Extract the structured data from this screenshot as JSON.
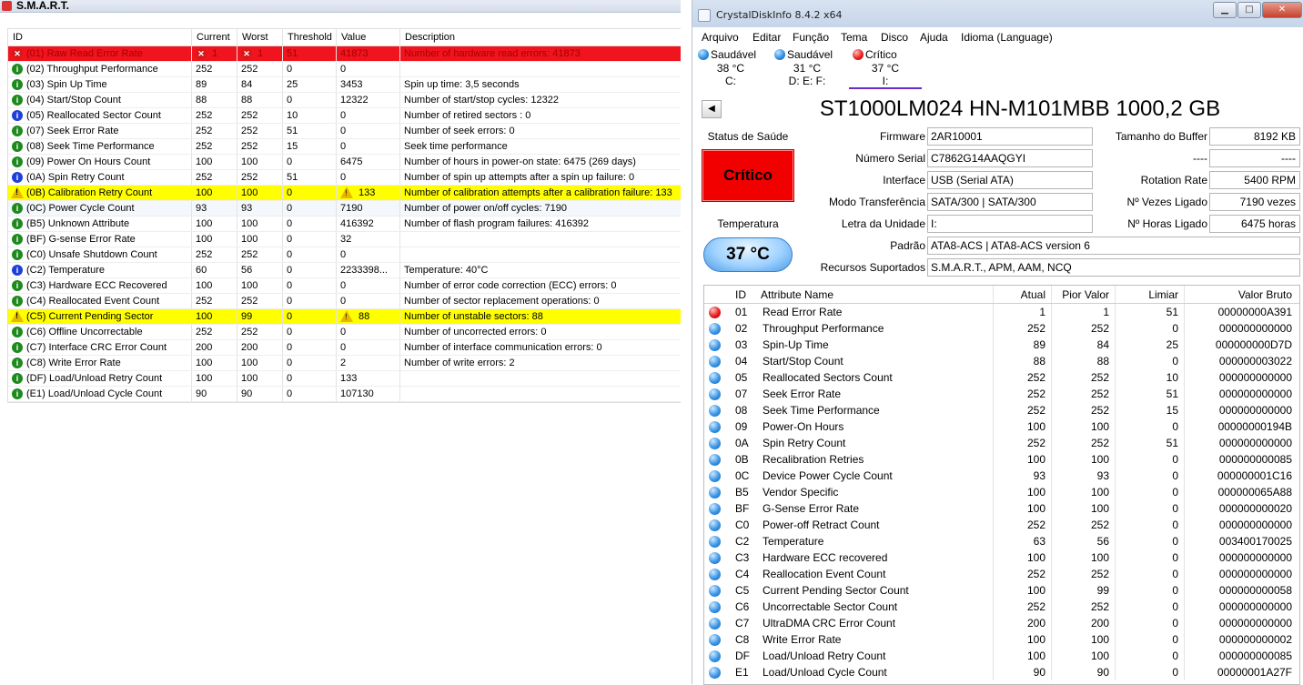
{
  "left": {
    "title": "S.M.A.R.T.",
    "headers": {
      "id": "ID",
      "current": "Current",
      "worst": "Worst",
      "threshold": "Threshold",
      "value": "Value",
      "description": "Description"
    },
    "rows": [
      {
        "status": "err",
        "name": "(01) Raw Read Error Rate",
        "current": "1",
        "worst": "1",
        "threshold": "51",
        "value": "41873",
        "desc": "Number of hardware read errors: 41873",
        "hl": "red",
        "icons": "err"
      },
      {
        "status": "ok",
        "name": "(02) Throughput Performance",
        "current": "252",
        "worst": "252",
        "threshold": "0",
        "value": "0",
        "desc": ""
      },
      {
        "status": "ok",
        "name": "(03) Spin Up Time",
        "current": "89",
        "worst": "84",
        "threshold": "25",
        "value": "3453",
        "desc": "Spin up time: 3,5 seconds"
      },
      {
        "status": "ok",
        "name": "(04) Start/Stop Count",
        "current": "88",
        "worst": "88",
        "threshold": "0",
        "value": "12322",
        "desc": "Number of start/stop cycles: 12322"
      },
      {
        "status": "info",
        "name": "(05) Reallocated Sector Count",
        "current": "252",
        "worst": "252",
        "threshold": "10",
        "value": "0",
        "desc": "Number of retired sectors : 0"
      },
      {
        "status": "ok",
        "name": "(07) Seek Error Rate",
        "current": "252",
        "worst": "252",
        "threshold": "51",
        "value": "0",
        "desc": "Number of seek errors: 0"
      },
      {
        "status": "ok",
        "name": "(08) Seek Time Performance",
        "current": "252",
        "worst": "252",
        "threshold": "15",
        "value": "0",
        "desc": "Seek time performance"
      },
      {
        "status": "ok",
        "name": "(09) Power On Hours Count",
        "current": "100",
        "worst": "100",
        "threshold": "0",
        "value": "6475",
        "desc": "Number of hours in power-on state: 6475 (269 days)"
      },
      {
        "status": "info",
        "name": "(0A) Spin Retry Count",
        "current": "252",
        "worst": "252",
        "threshold": "51",
        "value": "0",
        "desc": "Number of spin up attempts after a spin up failure: 0"
      },
      {
        "status": "warn",
        "name": "(0B) Calibration Retry Count",
        "current": "100",
        "worst": "100",
        "threshold": "0",
        "value": "133",
        "desc": "Number of calibration attempts after a calibration failure: 133",
        "hl": "yel",
        "icons": "warn"
      },
      {
        "status": "ok",
        "name": "(0C) Power Cycle Count",
        "current": "93",
        "worst": "93",
        "threshold": "0",
        "value": "7190",
        "desc": "Number of power on/off cycles: 7190",
        "hl": "sel"
      },
      {
        "status": "ok",
        "name": "(B5) Unknown Attribute",
        "current": "100",
        "worst": "100",
        "threshold": "0",
        "value": "416392",
        "desc": "Number of flash program failures: 416392"
      },
      {
        "status": "ok",
        "name": "(BF) G-sense Error Rate",
        "current": "100",
        "worst": "100",
        "threshold": "0",
        "value": "32",
        "desc": ""
      },
      {
        "status": "ok",
        "name": "(C0) Unsafe Shutdown Count",
        "current": "252",
        "worst": "252",
        "threshold": "0",
        "value": "0",
        "desc": ""
      },
      {
        "status": "info",
        "name": "(C2) Temperature",
        "current": "60",
        "worst": "56",
        "threshold": "0",
        "value": "2233398...",
        "desc": "Temperature: 40°C"
      },
      {
        "status": "ok",
        "name": "(C3) Hardware ECC Recovered",
        "current": "100",
        "worst": "100",
        "threshold": "0",
        "value": "0",
        "desc": "Number of error code correction (ECC) errors: 0"
      },
      {
        "status": "ok",
        "name": "(C4) Reallocated Event Count",
        "current": "252",
        "worst": "252",
        "threshold": "0",
        "value": "0",
        "desc": "Number of sector replacement operations: 0"
      },
      {
        "status": "warn",
        "name": "(C5) Current Pending Sector",
        "current": "100",
        "worst": "99",
        "threshold": "0",
        "value": "88",
        "desc": "Number of unstable sectors: 88",
        "hl": "yel",
        "icons": "warn"
      },
      {
        "status": "ok",
        "name": "(C6) Offline Uncorrectable",
        "current": "252",
        "worst": "252",
        "threshold": "0",
        "value": "0",
        "desc": "Number of uncorrected errors: 0"
      },
      {
        "status": "ok",
        "name": "(C7) Interface CRC Error Count",
        "current": "200",
        "worst": "200",
        "threshold": "0",
        "value": "0",
        "desc": "Number of interface communication errors: 0"
      },
      {
        "status": "ok",
        "name": "(C8) Write Error Rate",
        "current": "100",
        "worst": "100",
        "threshold": "0",
        "value": "2",
        "desc": "Number of write errors: 2"
      },
      {
        "status": "ok",
        "name": "(DF) Load/Unload Retry Count",
        "current": "100",
        "worst": "100",
        "threshold": "0",
        "value": "133",
        "desc": ""
      },
      {
        "status": "ok",
        "name": "(E1) Load/Unload Cycle Count",
        "current": "90",
        "worst": "90",
        "threshold": "0",
        "value": "107130",
        "desc": ""
      }
    ]
  },
  "right": {
    "window_title": "CrystalDiskInfo 8.4.2 x64",
    "menu": [
      "Arquivo",
      "Editar",
      "Função",
      "Tema",
      "Disco",
      "Ajuda",
      "Idioma (Language)"
    ],
    "drives": [
      {
        "status": "Saudável",
        "temp": "38 °C",
        "letter": "C:",
        "color": "blue"
      },
      {
        "status": "Saudável",
        "temp": "31 °C",
        "letter": "D: E: F:",
        "color": "blue"
      },
      {
        "status": "Crítico",
        "temp": "37 °C",
        "letter": "I:",
        "color": "red"
      }
    ],
    "model": "ST1000LM024 HN-M101MBB 1000,2 GB",
    "health_label": "Status de Saúde",
    "health_value": "Crítico",
    "temp_label": "Temperatura",
    "temp_value": "37 °C",
    "fields": {
      "firmware_label": "Firmware",
      "firmware": "2AR10001",
      "serial_label": "Número Serial",
      "serial": "C7862G14AAQGYI",
      "interface_label": "Interface",
      "interface": "USB (Serial ATA)",
      "transfer_label": "Modo Transferência",
      "transfer": "SATA/300 | SATA/300",
      "drive_letter_label": "Letra da Unidade",
      "drive_letter": "I:",
      "standard_label": "Padrão",
      "standard": "ATA8-ACS | ATA8-ACS version 6",
      "features_label": "Recursos Suportados",
      "features": "S.M.A.R.T., APM, AAM, NCQ",
      "buffer_label": "Tamanho do Buffer",
      "buffer": "8192 KB",
      "blank1_label": "----",
      "blank1": "----",
      "rotation_label": "Rotation Rate",
      "rotation": "5400 RPM",
      "power_count_label": "Nº Vezes Ligado",
      "power_count": "7190 vezes",
      "power_hours_label": "Nº Horas Ligado",
      "power_hours": "6475 horas"
    },
    "headers": {
      "id": "ID",
      "name": "Attribute Name",
      "current": "Atual",
      "worst": "Pior Valor",
      "threshold": "Limiar",
      "raw": "Valor Bruto"
    },
    "rows": [
      {
        "c": "red",
        "id": "01",
        "name": "Read Error Rate",
        "cur": "1",
        "worst": "1",
        "thr": "51",
        "raw": "00000000A391"
      },
      {
        "c": "blue",
        "id": "02",
        "name": "Throughput Performance",
        "cur": "252",
        "worst": "252",
        "thr": "0",
        "raw": "000000000000"
      },
      {
        "c": "blue",
        "id": "03",
        "name": "Spin-Up Time",
        "cur": "89",
        "worst": "84",
        "thr": "25",
        "raw": "000000000D7D"
      },
      {
        "c": "blue",
        "id": "04",
        "name": "Start/Stop Count",
        "cur": "88",
        "worst": "88",
        "thr": "0",
        "raw": "000000003022"
      },
      {
        "c": "blue",
        "id": "05",
        "name": "Reallocated Sectors Count",
        "cur": "252",
        "worst": "252",
        "thr": "10",
        "raw": "000000000000"
      },
      {
        "c": "blue",
        "id": "07",
        "name": "Seek Error Rate",
        "cur": "252",
        "worst": "252",
        "thr": "51",
        "raw": "000000000000"
      },
      {
        "c": "blue",
        "id": "08",
        "name": "Seek Time Performance",
        "cur": "252",
        "worst": "252",
        "thr": "15",
        "raw": "000000000000"
      },
      {
        "c": "blue",
        "id": "09",
        "name": "Power-On Hours",
        "cur": "100",
        "worst": "100",
        "thr": "0",
        "raw": "00000000194B"
      },
      {
        "c": "blue",
        "id": "0A",
        "name": "Spin Retry Count",
        "cur": "252",
        "worst": "252",
        "thr": "51",
        "raw": "000000000000"
      },
      {
        "c": "blue",
        "id": "0B",
        "name": "Recalibration Retries",
        "cur": "100",
        "worst": "100",
        "thr": "0",
        "raw": "000000000085"
      },
      {
        "c": "blue",
        "id": "0C",
        "name": "Device Power Cycle Count",
        "cur": "93",
        "worst": "93",
        "thr": "0",
        "raw": "000000001C16"
      },
      {
        "c": "blue",
        "id": "B5",
        "name": "Vendor Specific",
        "cur": "100",
        "worst": "100",
        "thr": "0",
        "raw": "000000065A88"
      },
      {
        "c": "blue",
        "id": "BF",
        "name": "G-Sense Error Rate",
        "cur": "100",
        "worst": "100",
        "thr": "0",
        "raw": "000000000020"
      },
      {
        "c": "blue",
        "id": "C0",
        "name": "Power-off Retract Count",
        "cur": "252",
        "worst": "252",
        "thr": "0",
        "raw": "000000000000"
      },
      {
        "c": "blue",
        "id": "C2",
        "name": "Temperature",
        "cur": "63",
        "worst": "56",
        "thr": "0",
        "raw": "003400170025"
      },
      {
        "c": "blue",
        "id": "C3",
        "name": "Hardware ECC recovered",
        "cur": "100",
        "worst": "100",
        "thr": "0",
        "raw": "000000000000"
      },
      {
        "c": "blue",
        "id": "C4",
        "name": "Reallocation Event Count",
        "cur": "252",
        "worst": "252",
        "thr": "0",
        "raw": "000000000000"
      },
      {
        "c": "blue",
        "id": "C5",
        "name": "Current Pending Sector Count",
        "cur": "100",
        "worst": "99",
        "thr": "0",
        "raw": "000000000058"
      },
      {
        "c": "blue",
        "id": "C6",
        "name": "Uncorrectable Sector Count",
        "cur": "252",
        "worst": "252",
        "thr": "0",
        "raw": "000000000000"
      },
      {
        "c": "blue",
        "id": "C7",
        "name": "UltraDMA CRC Error Count",
        "cur": "200",
        "worst": "200",
        "thr": "0",
        "raw": "000000000000"
      },
      {
        "c": "blue",
        "id": "C8",
        "name": "Write Error Rate",
        "cur": "100",
        "worst": "100",
        "thr": "0",
        "raw": "000000000002"
      },
      {
        "c": "blue",
        "id": "DF",
        "name": "Load/Unload Retry Count",
        "cur": "100",
        "worst": "100",
        "thr": "0",
        "raw": "000000000085"
      },
      {
        "c": "blue",
        "id": "E1",
        "name": "Load/Unload Cycle Count",
        "cur": "90",
        "worst": "90",
        "thr": "0",
        "raw": "00000001A27F"
      }
    ]
  }
}
